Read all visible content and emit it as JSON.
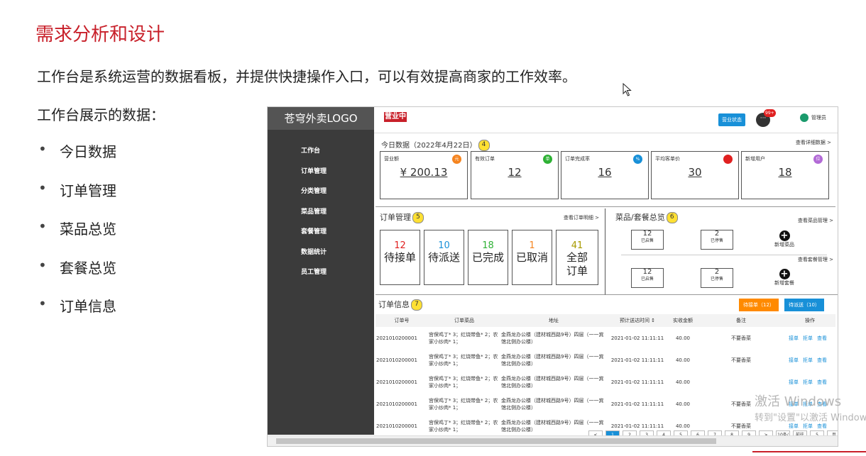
{
  "slide": {
    "title": "需求分析和设计",
    "intro": "工作台是系统运营的数据看板，并提供快捷操作入口，可以有效提高商家的工作效率。",
    "list_title": "工作台展示的数据：",
    "bullets": [
      "今日数据",
      "订单管理",
      "菜品总览",
      "套餐总览",
      "订单信息"
    ]
  },
  "app": {
    "logo": "苍穹外卖LOGO",
    "nav": [
      "工作台",
      "订单管理",
      "分类管理",
      "菜品管理",
      "套餐管理",
      "数据统计",
      "员工管理"
    ],
    "open_status": "营业中",
    "status_button": "营业状态",
    "chat_badge": "99+",
    "chat_icon": "···",
    "admin": "管理员"
  },
  "today": {
    "title": "今日数据（2022年4月22日）",
    "marker": "4",
    "more": "查看详细数据 >",
    "cards": [
      {
        "label": "营业额",
        "value": "¥ 200.13",
        "icon": "元",
        "color": "#f5841f"
      },
      {
        "label": "有效订单",
        "value": "12",
        "icon": "单",
        "color": "#2eb135"
      },
      {
        "label": "订单完成率",
        "value": "16",
        "icon": "%",
        "color": "#1890d8"
      },
      {
        "label": "平均客单价",
        "value": "30",
        "icon": "",
        "color": "#e02020"
      },
      {
        "label": "新增用户",
        "value": "18",
        "icon": "位",
        "color": "#b26ad6"
      }
    ]
  },
  "orders": {
    "title": "订单管理",
    "marker": "5",
    "more": "查看订单明细 >",
    "boxes": [
      {
        "num": "12",
        "text": "待接单",
        "color": "#e02020"
      },
      {
        "num": "10",
        "text": "待派送",
        "color": "#1890d8"
      },
      {
        "num": "18",
        "text": "已完成",
        "color": "#2eb135"
      },
      {
        "num": "1",
        "text": "已取消",
        "color": "#f5841f"
      },
      {
        "num": "41",
        "text": "全部订单",
        "color": "#a89a00"
      }
    ]
  },
  "dishes": {
    "title": "菜品/套餐总览",
    "marker": "6",
    "more_dish": "查看菜品管理 >",
    "more_set": "查看套餐管理 >",
    "dish_on": "12",
    "dish_on_label": "已启售",
    "dish_off": "2",
    "dish_off_label": "已停售",
    "add_dish": "新增菜品",
    "set_on": "12",
    "set_on_label": "已启售",
    "set_off": "2",
    "set_off_label": "已停售",
    "add_set": "新增套餐"
  },
  "info": {
    "title": "订单信息",
    "marker": "7",
    "pending_btn": "待接单（12）",
    "deliver_btn": "待派送（10）",
    "columns": [
      "订单号",
      "订单菜品",
      "地址",
      "预计送达时间 ↕",
      "实收金额",
      "备注",
      "操作"
    ],
    "rows": [
      {
        "id": "2021010200001",
        "dishes": "宫保鸡丁* 3；红烧带鱼* 2；农家小炒肉* 1；",
        "address": "金燕龙办公楼（建材城西路9号）四层（一一宾馆北侧办公楼）",
        "time": "2021-01-02 11:11:11",
        "amount": "40.00",
        "note": "不要香菜",
        "ops": [
          "接单",
          "拒单",
          "查看"
        ]
      },
      {
        "id": "2021010200001",
        "dishes": "宫保鸡丁* 3；红烧带鱼* 2；农家小炒肉* 1；",
        "address": "金燕龙办公楼（建材城西路9号）四层（一一宾馆北侧办公楼）",
        "time": "2021-01-02 11:11:11",
        "amount": "40.00",
        "note": "不要香菜",
        "ops": [
          "接单",
          "拒单",
          "查看"
        ]
      },
      {
        "id": "2021010200001",
        "dishes": "宫保鸡丁* 3；红烧带鱼* 2；农家小炒肉* 1；",
        "address": "金燕龙办公楼（建材城西路9号）四层（一一宾馆北侧办公楼）",
        "time": "2021-01-02 11:11:11",
        "amount": "40.00",
        "note": "",
        "ops": [
          "接单",
          "拒单",
          "查看"
        ]
      },
      {
        "id": "2021010200001",
        "dishes": "宫保鸡丁* 3；红烧带鱼* 2；农家小炒肉* 1；",
        "address": "金燕龙办公楼（建材城西路9号）四层（一一宾馆北侧办公楼）",
        "time": "2021-01-02 11:11:11",
        "amount": "40.00",
        "note": "不要香菜",
        "ops": [
          "接单",
          "拒单",
          "查看"
        ]
      },
      {
        "id": "2021010200001",
        "dishes": "宫保鸡丁* 3；红烧带鱼* 2；农家小炒肉* 1；",
        "address": "金燕龙办公楼（建材城西路9号）四层（一一宾馆北侧办公楼）",
        "time": "2021-01-02 11:11:11",
        "amount": "40.00",
        "note": "不要香菜",
        "ops": [
          "接单",
          "拒单",
          "查看"
        ]
      }
    ],
    "pages": [
      "<",
      "1",
      "2",
      "3",
      "4",
      "5",
      "6",
      "7",
      "8",
      "9",
      ">",
      "10条/页",
      "前往",
      "5",
      "页"
    ]
  },
  "watermark": {
    "line1": "激活 Windows",
    "line2": "转到\"设置\"以激活 Windows。"
  }
}
